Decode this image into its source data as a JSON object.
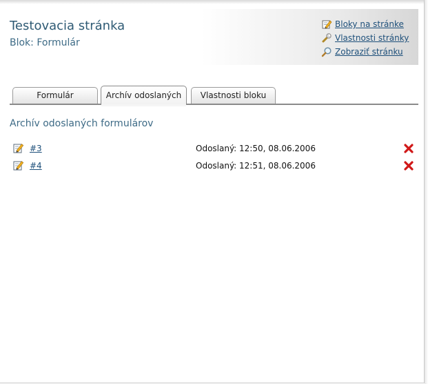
{
  "header": {
    "title": "Testovacia stránka",
    "subtitle": "Blok: Formulár",
    "links": [
      {
        "label": "Bloky na stránke",
        "icon": "edit-pencil-icon"
      },
      {
        "label": "Vlastnosti stránky",
        "icon": "wrench-icon"
      },
      {
        "label": "Zobraziť stránku",
        "icon": "magnifier-icon"
      }
    ]
  },
  "tabs": [
    {
      "label": "Formulár",
      "active": false
    },
    {
      "label": "Archív odoslaných",
      "active": true
    },
    {
      "label": "Vlastnosti bloku",
      "active": false
    }
  ],
  "archive": {
    "heading": "Archív odoslaných formulárov",
    "rows": [
      {
        "id": "#3",
        "sent": "Odoslaný: 12:50, 08.06.2006"
      },
      {
        "id": "#4",
        "sent": "Odoslaný: 12:51, 08.06.2006"
      }
    ]
  },
  "colors": {
    "title": "#2e5a74",
    "link": "#1d4f7a",
    "delete": "#d01818",
    "tab_border": "#8a8a8a"
  }
}
